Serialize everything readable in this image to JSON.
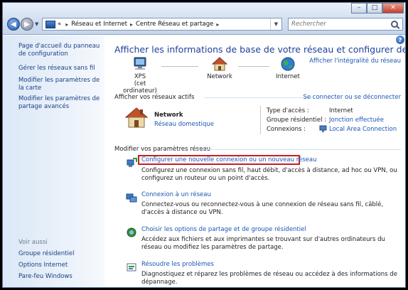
{
  "window": {
    "controls": {
      "minimize": "–",
      "maximize": "□",
      "close": "✕"
    }
  },
  "toolbar": {
    "address_prefix": "«",
    "breadcrumbs": [
      "Réseau et Internet",
      "Centre Réseau et partage"
    ],
    "separator": "▸",
    "search_placeholder": "Rechercher"
  },
  "sidebar": {
    "links": [
      "Page d'accueil du panneau de configuration",
      "Gérer les réseaux sans fil",
      "Modifier les paramètres de la carte",
      "Modifier les paramètres de partage avancés"
    ],
    "see_also_label": "Voir aussi",
    "see_also_links": [
      "Groupe résidentiel",
      "Options Internet",
      "Pare-feu Windows"
    ]
  },
  "main": {
    "title": "Afficher les informations de base de votre réseau et configurer des connexions",
    "see_all": "Afficher l'intégralité du réseau",
    "map": {
      "computer_name": "XPS",
      "computer_sub": "(cet ordinateur)",
      "network": "Network",
      "internet": "Internet"
    },
    "active_networks": {
      "label": "Afficher vos réseaux actifs",
      "connect_link": "Se connecter ou se déconnecter",
      "network_name": "Network",
      "network_type": "Réseau domestique",
      "props": [
        {
          "label": "Type d'accès :",
          "value": "Internet",
          "link": false
        },
        {
          "label": "Groupe résidentiel :",
          "value": "Jonction effectuée",
          "link": true
        },
        {
          "label": "Connexions :",
          "value": "Local Area Connection",
          "link": true
        }
      ]
    },
    "settings": {
      "label": "Modifier vos paramètres réseau",
      "tasks": [
        {
          "title": "Configurer une nouvelle connexion ou un nouveau réseau",
          "description": "Configurez une connexion sans fil, haut débit, d'accès à distance, ad hoc ou VPN, ou configurez un routeur ou un point d'accès."
        },
        {
          "title": "Connexion à un réseau",
          "description": "Connectez-vous ou reconnectez-vous à une connexion de réseau sans fil, câblé, d'accès à distance ou VPN."
        },
        {
          "title": "Choisir les options de partage et de groupe résidentiel",
          "description": "Accédez aux fichiers et aux imprimantes se trouvant sur d'autres ordinateurs du réseau ou modifiez les paramètres de partage."
        },
        {
          "title": "Résoudre les problèmes",
          "description": "Diagnostiquez et réparez les problèmes de réseau ou accédez à des informations de dépannage."
        }
      ]
    }
  },
  "colors": {
    "link": "#1b56b6",
    "title": "#1d3f97",
    "highlight": "#c81d25"
  }
}
